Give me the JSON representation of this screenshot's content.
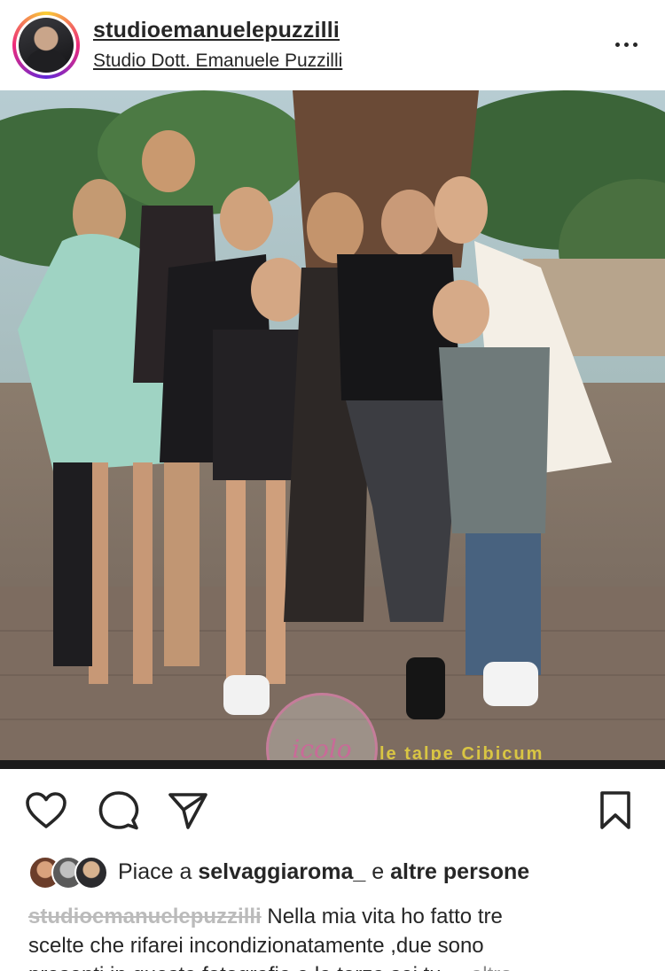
{
  "header": {
    "username": "studioemanuelepuzzilli",
    "subtitle": "Studio Dott. Emanuele Puzzilli",
    "avatar_icon": "profile-avatar",
    "more_icon": "more-horizontal-icon"
  },
  "photo": {
    "watermark_logo": "icolo",
    "watermark_text": "le talpe Cibicum",
    "colors": {
      "sky": "#a8c0c7",
      "foliage": "#3f5a3a",
      "stone": "#9c8a78"
    }
  },
  "actions": {
    "like_icon": "heart-icon",
    "comment_icon": "comment-icon",
    "share_icon": "send-icon",
    "save_icon": "bookmark-icon"
  },
  "likes": {
    "prefix": "Piace a",
    "user": "selvaggiaroma_",
    "conjunction": "e",
    "others": "altre persone"
  },
  "caption": {
    "username": "studioemanuelepuzzilli",
    "line1": "Nella mia vita ho fatto tre",
    "line2": "scelte  che rifarei incondizionatamente ,due sono",
    "line3": "presenti in questa fotografia e la terza sei tu",
    "more": "altro"
  }
}
